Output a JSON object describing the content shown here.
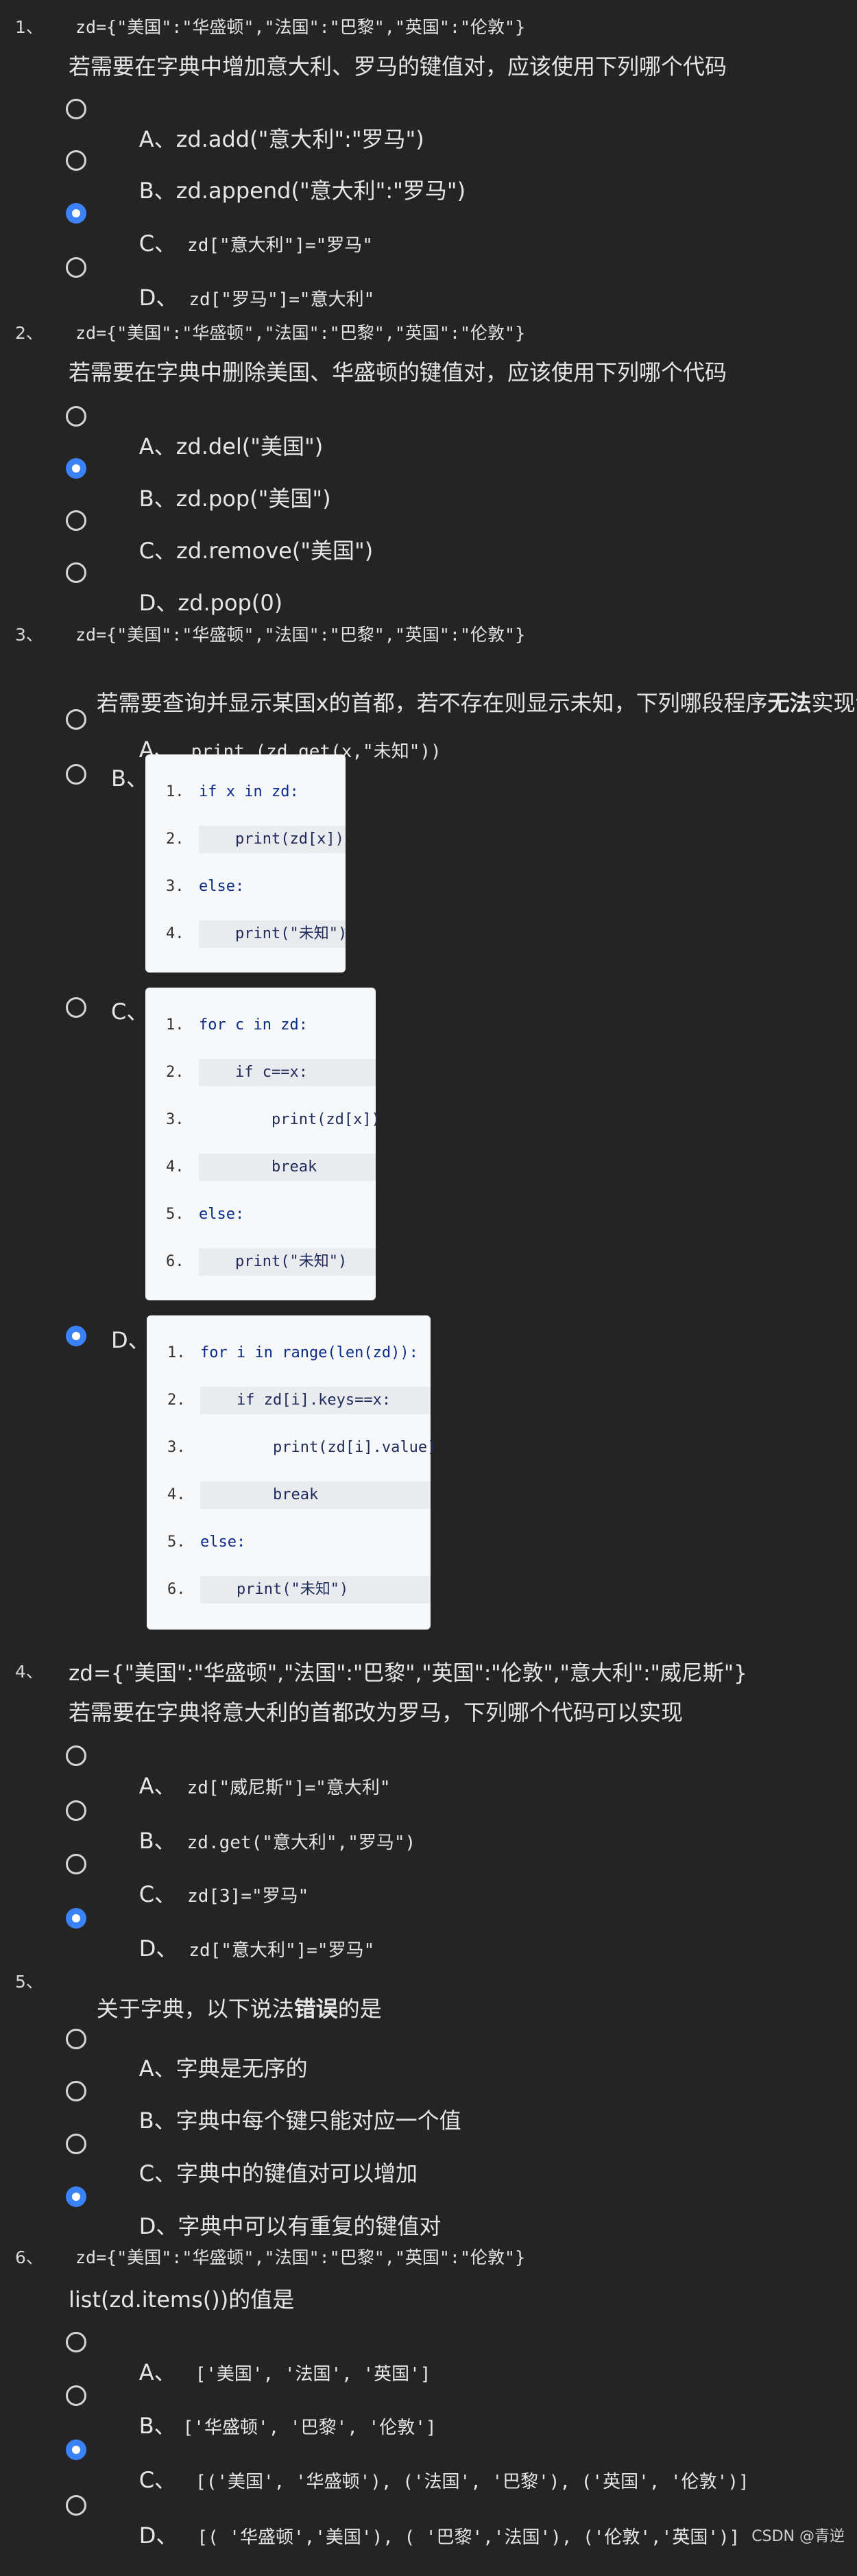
{
  "questions": [
    {
      "num": "1、",
      "stem_code": "zd={\"美国\":\"华盛顿\",\"法国\":\"巴黎\",\"英国\":\"伦敦\"}",
      "stem_text": "若需要在字典中增加意大利、罗马的键值对，应该使用下列哪个代码",
      "options": [
        {
          "prefix": "A、",
          "text": "zd.add(\"意大利\":\"罗马\")",
          "selected": false
        },
        {
          "prefix": "B、",
          "text": "zd.append(\"意大利\":\"罗马\")",
          "selected": false
        },
        {
          "prefix": "C、",
          "text": "zd[\"意大利\"]=\"罗马\"",
          "selected": true
        },
        {
          "prefix": "D、",
          "text": "zd[\"罗马\"]=\"意大利\"",
          "selected": false
        }
      ]
    },
    {
      "num": "2、",
      "stem_code": "zd={\"美国\":\"华盛顿\",\"法国\":\"巴黎\",\"英国\":\"伦敦\"}",
      "stem_text": "若需要在字典中删除美国、华盛顿的键值对，应该使用下列哪个代码",
      "options": [
        {
          "prefix": "A、",
          "text": "zd.del(\"美国\")",
          "selected": false
        },
        {
          "prefix": "B、",
          "text": "zd.pop(\"美国\")",
          "selected": true
        },
        {
          "prefix": "C、",
          "text": "zd.remove(\"美国\")",
          "selected": false
        },
        {
          "prefix": "D、",
          "text": "zd.pop(0)",
          "selected": false
        }
      ]
    },
    {
      "num": "3、",
      "stem_code": "zd={\"美国\":\"华盛顿\",\"法国\":\"巴黎\",\"英国\":\"伦敦\"}",
      "stem_text_a": "若需要查询并显示某国x的首都，若不存在则显示未知，下列哪段程序",
      "stem_text_bold": "无法",
      "stem_text_b": "实现该",
      "options": [
        {
          "prefix": "A、",
          "text": "print (zd.get(x,\"未知\"))",
          "selected": false
        },
        {
          "prefix": "B、",
          "selected": false,
          "code": [
            "if x in zd:",
            "    print(zd[x])",
            "else:",
            "    print(\"未知\")"
          ],
          "line_nums": [
            "1.",
            "2.",
            "3.",
            "4."
          ]
        },
        {
          "prefix": "C、",
          "selected": false,
          "code": [
            "for c in zd:",
            "    if c==x:",
            "        print(zd[x])",
            "        break",
            "else:",
            "    print(\"未知\")"
          ],
          "line_nums": [
            "1.",
            "2.",
            "3.",
            "4.",
            "5.",
            "6."
          ]
        },
        {
          "prefix": "D、",
          "selected": true,
          "code": [
            "for i in range(len(zd)):",
            "    if zd[i].keys==x:",
            "        print(zd[i].value)",
            "        break",
            "else:",
            "    print(\"未知\")"
          ],
          "line_nums": [
            "1.",
            "2.",
            "3.",
            "4.",
            "5.",
            "6."
          ]
        }
      ]
    },
    {
      "num": "4、",
      "stem_line1": "zd={\"美国\":\"华盛顿\",\"法国\":\"巴黎\",\"英国\":\"伦敦\",\"意大利\":\"威尼斯\"}",
      "stem_text": "若需要在字典将意大利的首都改为罗马，下列哪个代码可以实现",
      "options": [
        {
          "prefix": "A、",
          "text": "zd[\"威尼斯\"]=\"意大利\"",
          "selected": false
        },
        {
          "prefix": "B、",
          "text": "zd.get(\"意大利\",\"罗马\")",
          "selected": false
        },
        {
          "prefix": "C、",
          "text": "zd[3]=\"罗马\"",
          "selected": false
        },
        {
          "prefix": "D、",
          "text": "zd[\"意大利\"]=\"罗马\"",
          "selected": true
        }
      ]
    },
    {
      "num": "5、",
      "stem_text_a": "关于字典，以下说法",
      "stem_text_bold": "错误",
      "stem_text_b": "的是",
      "options": [
        {
          "prefix": "A、",
          "text": "字典是无序的",
          "selected": false
        },
        {
          "prefix": "B、",
          "text": "字典中每个键只能对应一个值",
          "selected": false
        },
        {
          "prefix": "C、",
          "text": "字典中的键值对可以增加",
          "selected": false
        },
        {
          "prefix": "D、",
          "text": "字典中可以有重复的键值对",
          "selected": true
        }
      ]
    },
    {
      "num": "6、",
      "stem_code": "zd={\"美国\":\"华盛顿\",\"法国\":\"巴黎\",\"英国\":\"伦敦\"}",
      "stem_text": "list(zd.items())的值是",
      "options": [
        {
          "prefix": "A、",
          "text": "['美国', '法国', '英国']",
          "selected": false
        },
        {
          "prefix": "B、",
          "text": "['华盛顿', '巴黎', '伦敦']",
          "selected": false
        },
        {
          "prefix": "C、",
          "text": "[('美国', '华盛顿'), ('法国', '巴黎'), ('英国', '伦敦')]",
          "selected": true
        },
        {
          "prefix": "D、",
          "text": "[( '华盛顿','美国'), ( '巴黎','法国'), ('伦敦','英国')]",
          "selected": false
        }
      ]
    }
  ],
  "watermark": "CSDN @青逆",
  "colors": {
    "background": "#242424",
    "accent": "#3b82f6",
    "code_bg": "#f6f8fa"
  }
}
